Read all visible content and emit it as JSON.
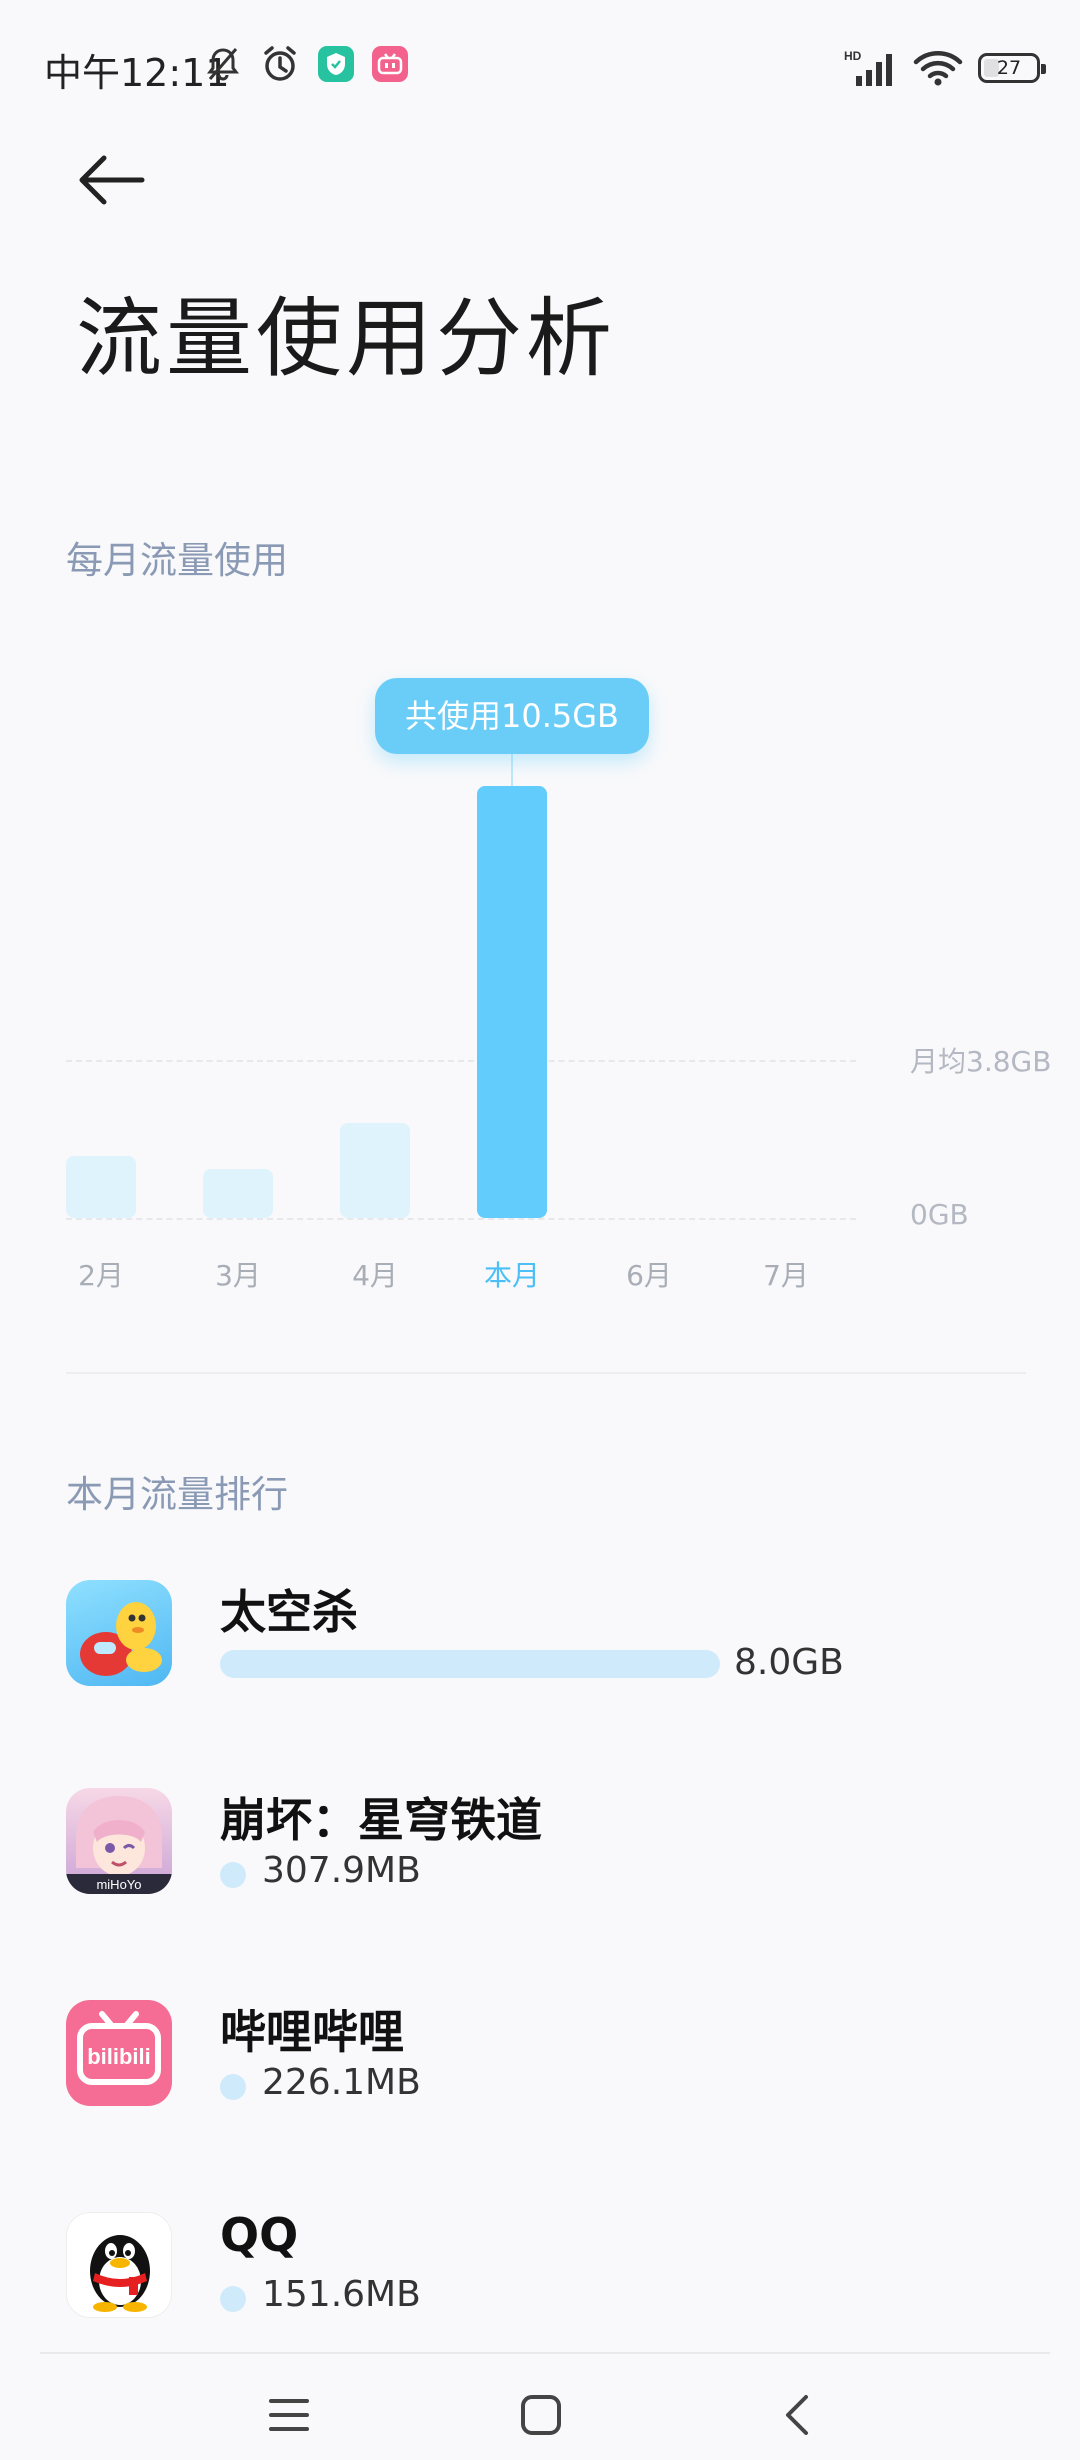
{
  "status_bar": {
    "time": "中午12:11",
    "network": "HD",
    "battery": "27",
    "battery_level_percent": 27,
    "left_icons": [
      "mute-bell-icon",
      "alarm-icon",
      "security-app-icon",
      "bilibili-app-icon"
    ],
    "right_icons": [
      "cellular-signal-icon",
      "wifi-icon",
      "battery-icon"
    ]
  },
  "header": {
    "title": "流量使用分析"
  },
  "monthly": {
    "section_title": "每月流量使用",
    "tooltip": "共使用10.5GB",
    "avg_label": "月均3.8GB",
    "zero_label": "0GB"
  },
  "chart_data": {
    "type": "bar",
    "categories": [
      "2月",
      "3月",
      "4月",
      "本月",
      "6月",
      "7月"
    ],
    "values": [
      1.5,
      1.2,
      2.3,
      10.5,
      null,
      null
    ],
    "unit": "GB",
    "average": 3.8,
    "highlighted_category": "本月",
    "ylim": [
      0,
      10.5
    ],
    "grid": true,
    "colors": {
      "normal": "#dff3fd",
      "current": "#62cdfd",
      "tooltip": "#6acdf7"
    }
  },
  "ranking": {
    "section_title": "本月流量排行",
    "max_value_gb": 8.0,
    "items": [
      {
        "name": "太空杀",
        "usage": "8.0GB",
        "usage_gb": 8.0,
        "icon": "space-kill-app-icon"
      },
      {
        "name": "崩坏：星穹铁道",
        "usage": "307.9MB",
        "usage_gb": 0.3079,
        "icon": "honkai-star-rail-app-icon"
      },
      {
        "name": "哔哩哔哩",
        "usage": "226.1MB",
        "usage_gb": 0.2261,
        "icon": "bilibili-app-icon"
      },
      {
        "name": "QQ",
        "usage": "151.6MB",
        "usage_gb": 0.1516,
        "icon": "qq-app-icon"
      }
    ]
  },
  "nav_bar": {
    "buttons": [
      "menu-icon",
      "home-icon",
      "back-icon"
    ]
  }
}
